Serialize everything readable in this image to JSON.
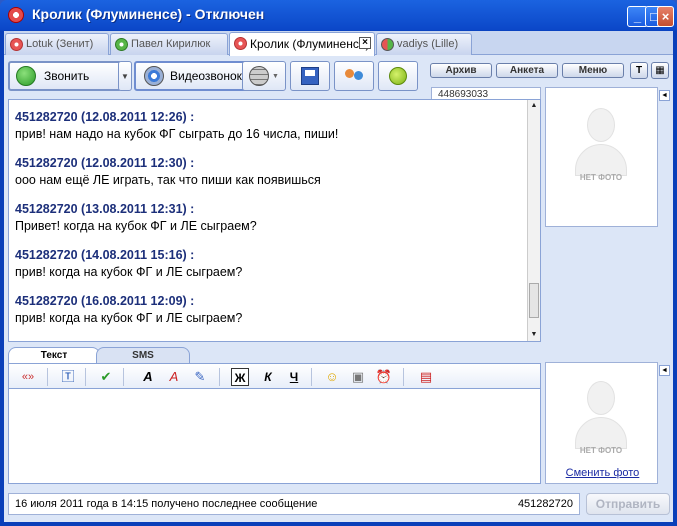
{
  "window": {
    "title": "Кролик (Флуминенсе) - Отключен",
    "controls": [
      "minimize",
      "maximize",
      "close"
    ]
  },
  "tabs": [
    {
      "label": "Lotuk (Зенит)",
      "icon": "red-flower-icon",
      "active": false
    },
    {
      "label": "Павел Кирилюк",
      "icon": "green-flower-icon",
      "active": false
    },
    {
      "label": "Кролик (Флуминенсе)",
      "icon": "red-flower-icon",
      "active": true
    },
    {
      "label": "vadiys (Lille)",
      "icon": "mixed-flower-icon",
      "active": false
    }
  ],
  "toolbar": {
    "call_label": "Звонить",
    "video_label": "Видеозвонок",
    "buttons_right": {
      "archive": "Архив",
      "profile": "Анкета",
      "menu": "Меню"
    },
    "contact_uid": "448693033"
  },
  "messages": [
    {
      "header": "451282720 (12.08.2011 12:26) :",
      "text": "прив! нам надо на кубок ФГ сыграть до 16 числа, пиши!"
    },
    {
      "header": "451282720 (12.08.2011 12:30) :",
      "text": "ооо нам ещё ЛЕ играть, так что пиши как появишься"
    },
    {
      "header": "451282720 (13.08.2011 12:31) :",
      "text": "Привет! когда на кубок ФГ и ЛЕ сыграем?"
    },
    {
      "header": "451282720 (14.08.2011 15:16) :",
      "text": "прив! когда на кубок ФГ и ЛЕ сыграем?"
    },
    {
      "header": "451282720 (16.08.2011 12:09) :",
      "text": "прив! когда на кубок ФГ и ЛЕ сыграем?"
    }
  ],
  "photo": {
    "no_photo_label": "НЕТ ФОТО",
    "change_photo_label": "Сменить фото"
  },
  "input_tabs": {
    "text": "Текст",
    "sms": "SMS"
  },
  "format": {
    "bold": "Ж",
    "italic": "К",
    "underline": "Ч"
  },
  "status": {
    "text": "16 июля 2011 года в 14:15 получено последнее сообщение",
    "uid": "451282720"
  },
  "send_label": "Отправить"
}
